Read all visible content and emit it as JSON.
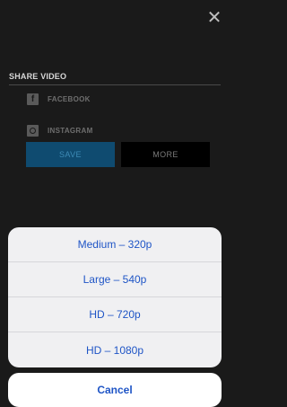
{
  "close": {
    "icon": "close-icon",
    "glyph": "✕"
  },
  "share": {
    "title": "SHARE VIDEO",
    "items": [
      {
        "label": "FACEBOOK",
        "icon": "facebook-icon",
        "glyph": "f"
      },
      {
        "label": "INSTAGRAM",
        "icon": "instagram-icon"
      }
    ],
    "save_label": "SAVE",
    "more_label": "MORE"
  },
  "sheet": {
    "options": [
      {
        "label": "Medium – 320p"
      },
      {
        "label": "Large – 540p"
      },
      {
        "label": "HD – 720p"
      },
      {
        "label": "HD – 1080p"
      }
    ],
    "cancel_label": "Cancel"
  },
  "colors": {
    "background": "#1a1a1a",
    "save_button": "#0f4b70",
    "sheet_text": "#1f55c6"
  }
}
